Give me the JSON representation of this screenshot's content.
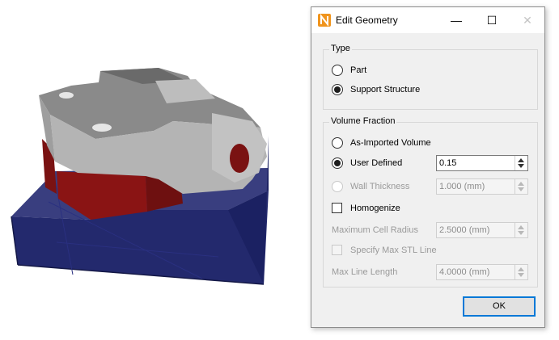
{
  "viewport": {
    "model": "3D part on support structure"
  },
  "dialog": {
    "title": "Edit Geometry",
    "app_icon": "N",
    "controls": {
      "minimize": "—",
      "maximize": "☐",
      "close": "✕"
    },
    "type_group": {
      "title": "Type",
      "options": [
        {
          "label": "Part",
          "checked": false
        },
        {
          "label": "Support Structure",
          "checked": true
        }
      ]
    },
    "volume_group": {
      "title": "Volume Fraction",
      "as_imported": {
        "label": "As-Imported Volume",
        "checked": false
      },
      "user_defined": {
        "label": "User Defined",
        "checked": true,
        "value": "0.15"
      },
      "wall_thickness": {
        "label": "Wall Thickness",
        "value": "1.000 (mm)",
        "enabled": false
      },
      "homogenize": {
        "label": "Homogenize",
        "checked": false
      },
      "max_cell_radius": {
        "label": "Maximum Cell Radius",
        "value": "2.5000 (mm)",
        "enabled": false
      },
      "specify_max_stl": {
        "label": "Specify Max STL Line",
        "checked": false,
        "enabled": false
      },
      "max_line_length": {
        "label": "Max Line Length",
        "value": "4.0000 (mm)",
        "enabled": false
      }
    },
    "ok_label": "OK"
  },
  "colors": {
    "accent": "#0078d7",
    "support_blue": "#1f2468",
    "part_gray": "#8f8f8f",
    "part_red": "#7a1212",
    "app_icon": "#f0941d"
  }
}
